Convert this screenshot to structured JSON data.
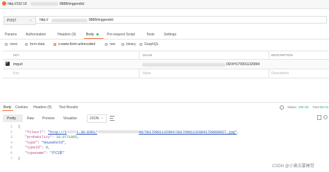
{
  "request": {
    "title": "http://192.16",
    "title_tail": "8888/imgpredict",
    "method": "POST",
    "url_start": "http://",
    "url_tail": "8888/imgpredict"
  },
  "request_tabs": [
    "Params",
    "Authorization",
    "Headers (9)",
    "Body",
    "Pre-request Script",
    "Tests",
    "Settings"
  ],
  "body_types": [
    "none",
    "form-data",
    "x-www-form-urlencoded",
    "raw",
    "binary",
    "GraphQL"
  ],
  "selected_body_type": "x-www-form-urlencoded",
  "params_table": {
    "headers": [
      "KEY",
      "VALUE",
      "DESCRIPTION"
    ],
    "rows": [
      {
        "checked": true,
        "key": "imgurl",
        "value_tail": "09/XH170901132984/",
        "description": ""
      }
    ],
    "placeholder": {
      "key": "Key",
      "value": "Value",
      "description": "Description"
    }
  },
  "response_tabs": [
    "Body",
    "Cookies",
    "Headers (5)",
    "Test Results"
  ],
  "response_status": {
    "label": "Status:",
    "value": "200 OK",
    "time_label": "Time:",
    "time_value": "59 ms"
  },
  "view_tabs": [
    "Pretty",
    "Raw",
    "Preview",
    "Visualize"
  ],
  "format": "JSON",
  "response_lines": [
    {
      "num": "1",
      "parts": [
        {
          "t": "{",
          "c": ""
        }
      ]
    },
    {
      "num": "2",
      "parts": [
        {
          "t": "\"fileurl\": ",
          "c": "json-key"
        },
        {
          "t": "\"http://1",
          "c": "json-url"
        },
        {
          "t": "1.38:8301/",
          "c": "json-url"
        },
        {
          "t": "09/XH170901132984/XH1709011329841700000027.jpg\"",
          "c": "json-url"
        },
        {
          "t": ",",
          "c": ""
        }
      ]
    },
    {
      "num": "3",
      "parts": [
        {
          "t": "\"probability\": ",
          "c": "json-key"
        },
        {
          "t": "33.0771865",
          "c": "json-num"
        },
        {
          "t": ",",
          "c": ""
        }
      ]
    },
    {
      "num": "4",
      "parts": [
        {
          "t": "\"type\": ",
          "c": "json-key"
        },
        {
          "t": "\"Household\"",
          "c": "json-str"
        },
        {
          "t": ",",
          "c": ""
        }
      ]
    },
    {
      "num": "5",
      "parts": [
        {
          "t": "\"typeId\": ",
          "c": "json-key"
        },
        {
          "t": "0",
          "c": "json-num"
        },
        {
          "t": ",",
          "c": ""
        }
      ]
    },
    {
      "num": "6",
      "parts": [
        {
          "t": "\"typename\": ",
          "c": "json-key"
        },
        {
          "t": "\"户口本\"",
          "c": "json-str"
        }
      ]
    },
    {
      "num": "7",
      "parts": [
        {
          "t": "}",
          "c": ""
        }
      ]
    }
  ],
  "watermark": "CSDN @小黄瓜要睡觉"
}
